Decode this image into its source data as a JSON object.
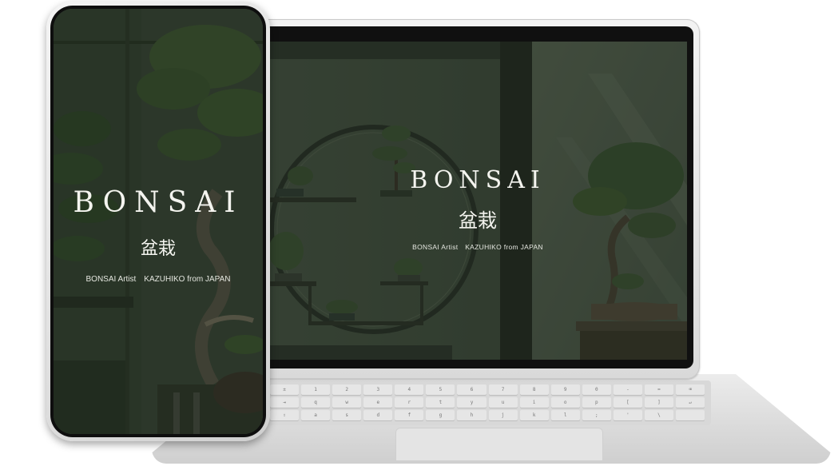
{
  "laptop": {
    "hero": {
      "title": "BONSAI",
      "kanji": "盆栽",
      "subtitle": "BONSAI Artist KAZUHIKO from JAPAN"
    },
    "keyboard_rows": [
      [
        "±",
        "1",
        "2",
        "3",
        "4",
        "5",
        "6",
        "7",
        "8",
        "9",
        "0",
        "-",
        "=",
        "⌫"
      ],
      [
        "⇥",
        "q",
        "w",
        "e",
        "r",
        "t",
        "y",
        "u",
        "i",
        "o",
        "p",
        "[",
        "]",
        "↵"
      ],
      [
        "⇪",
        "a",
        "s",
        "d",
        "f",
        "g",
        "h",
        "j",
        "k",
        "l",
        ";",
        "'",
        "\\",
        ""
      ]
    ]
  },
  "phone": {
    "hero": {
      "title": "BONSAI",
      "kanji": "盆栽",
      "subtitle": "BONSAI Artist KAZUHIKO from JAPAN"
    }
  },
  "colors": {
    "overlay": "#1c281c",
    "text": "#f4f4ef",
    "foliage": "#3c5232",
    "device_silver": "#d9d9d9"
  }
}
